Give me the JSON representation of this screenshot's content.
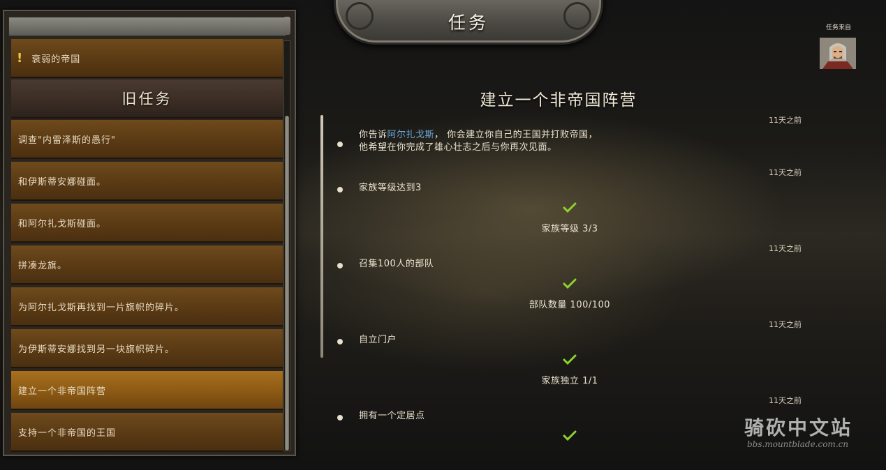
{
  "header": {
    "title": "任务"
  },
  "quest_giver": {
    "label": "任务来自"
  },
  "quest_list": {
    "active": [
      {
        "label": "衰弱的帝国"
      }
    ],
    "old_header": "旧任务",
    "old": [
      {
        "label": "调查\"内雷泽斯的愚行\""
      },
      {
        "label": "和伊斯蒂安娜碰面。"
      },
      {
        "label": "和阿尔扎戈斯碰面。"
      },
      {
        "label": "拼凑龙旗。"
      },
      {
        "label": "为阿尔扎戈斯再找到一片旗帜的碎片。"
      },
      {
        "label": "为伊斯蒂安娜找到另一块旗帜碎片。"
      },
      {
        "label": "建立一个非帝国阵营"
      },
      {
        "label": "支持一个非帝国的王国"
      }
    ],
    "selected_index": 6
  },
  "detail": {
    "title": "建立一个非帝国阵营",
    "entries": [
      {
        "time": "11天之前",
        "text_pre": "你告诉",
        "text_link": "阿尔扎戈斯",
        "text_post": "， 你会建立你自己的王国并打败帝国，",
        "text_line2": "他希望在你完成了雄心壮志之后与你再次见面。"
      },
      {
        "time": "11天之前",
        "text": "家族等级达到3",
        "progress": "家族等级 3/3"
      },
      {
        "time": "11天之前",
        "text": "召集100人的部队",
        "progress": "部队数量 100/100"
      },
      {
        "time": "11天之前",
        "text": "自立门户",
        "progress": "家族独立 1/1"
      },
      {
        "time": "11天之前",
        "text": "拥有一个定居点"
      }
    ]
  },
  "watermark": {
    "main": "骑砍中文站",
    "sub": "bbs.mountblade.com.cn"
  },
  "colors": {
    "check": "#8fd12e",
    "link": "#6aa7d8",
    "selected": "#a8701e"
  },
  "icons": {
    "check": "checkmark-icon",
    "exclaim": "exclamation-icon"
  }
}
